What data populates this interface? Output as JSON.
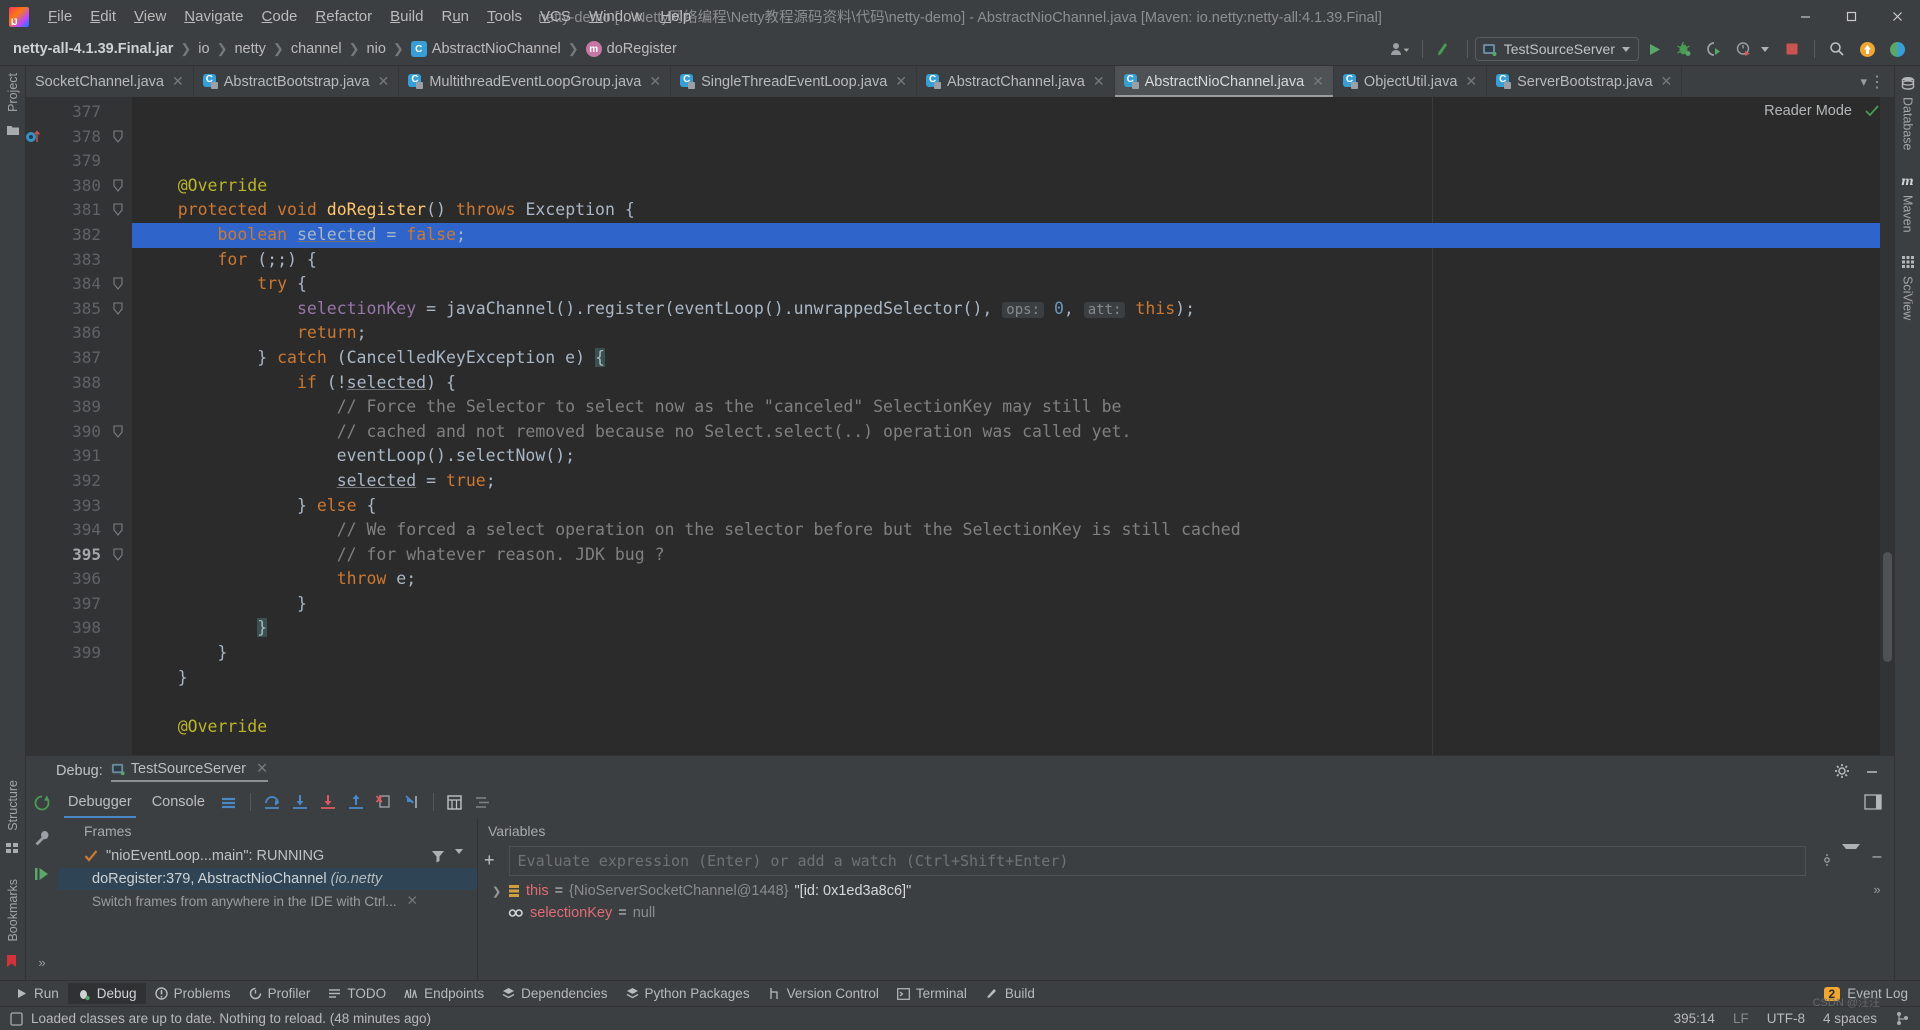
{
  "window": {
    "title": "netty-demo [...\\Netty网络编程\\Netty教程源码资料\\代码\\netty-demo] - AbstractNioChannel.java [Maven: io.netty:netty-all:4.1.39.Final]",
    "minimize_label": "–",
    "maximize_label": "❐",
    "close_label": "✕"
  },
  "menu": {
    "items": [
      {
        "label": "File",
        "accel": "F"
      },
      {
        "label": "Edit",
        "accel": "E"
      },
      {
        "label": "View",
        "accel": "V"
      },
      {
        "label": "Navigate",
        "accel": "N"
      },
      {
        "label": "Code",
        "accel": "C"
      },
      {
        "label": "Refactor",
        "accel": "R"
      },
      {
        "label": "Build",
        "accel": "B"
      },
      {
        "label": "Run",
        "accel": "u"
      },
      {
        "label": "Tools",
        "accel": "T"
      },
      {
        "label": "VCS",
        "accel": "V"
      },
      {
        "label": "Window",
        "accel": "W"
      },
      {
        "label": "Help",
        "accel": "H"
      }
    ]
  },
  "breadcrumb": {
    "items": [
      {
        "label": "netty-all-4.1.39.Final.jar",
        "icon": "",
        "bold": true
      },
      {
        "label": "io",
        "icon": ""
      },
      {
        "label": "netty",
        "icon": ""
      },
      {
        "label": "channel",
        "icon": ""
      },
      {
        "label": "nio",
        "icon": ""
      },
      {
        "label": "AbstractNioChannel",
        "icon": "class-icon"
      },
      {
        "label": "doRegister",
        "icon": "method-icon"
      }
    ],
    "separator": "❯"
  },
  "toolbar": {
    "run_config": "TestSourceServer",
    "icons": [
      {
        "name": "user-accounts-icon"
      },
      {
        "name": "vcs-update-icon"
      },
      {
        "name": "run-icon"
      },
      {
        "name": "debug-icon"
      },
      {
        "name": "run-coverage-icon"
      },
      {
        "name": "profiler-icon"
      },
      {
        "name": "stop-icon"
      },
      {
        "name": "search-everywhere-icon"
      },
      {
        "name": "notifications-icon"
      },
      {
        "name": "ide-feature-icon"
      }
    ]
  },
  "editor_tabs": [
    {
      "label": "SocketChannel.java",
      "active": false,
      "has_icon": false
    },
    {
      "label": "AbstractBootstrap.java",
      "active": false,
      "has_icon": true
    },
    {
      "label": "MultithreadEventLoopGroup.java",
      "active": false,
      "has_icon": true
    },
    {
      "label": "SingleThreadEventLoop.java",
      "active": false,
      "has_icon": true
    },
    {
      "label": "AbstractChannel.java",
      "active": false,
      "has_icon": true
    },
    {
      "label": "AbstractNioChannel.java",
      "active": true,
      "has_icon": true
    },
    {
      "label": "ObjectUtil.java",
      "active": false,
      "has_icon": true
    },
    {
      "label": "ServerBootstrap.java",
      "active": false,
      "has_icon": true
    }
  ],
  "editor": {
    "reader_mode_label": "Reader Mode",
    "first_line": 377,
    "highlight_line": 379,
    "current_line_marker": 395,
    "lines": [
      {
        "no": 377,
        "tokens": [
          {
            "t": "    ",
            "c": "id"
          },
          {
            "t": "@Override",
            "c": "ann"
          }
        ]
      },
      {
        "no": 378,
        "fold": true,
        "bp": true,
        "tokens": [
          {
            "t": "    ",
            "c": "id"
          },
          {
            "t": "protected",
            "c": "kw"
          },
          {
            "t": " ",
            "c": "id"
          },
          {
            "t": "void",
            "c": "kw"
          },
          {
            "t": " ",
            "c": "id"
          },
          {
            "t": "doRegister",
            "c": "mth"
          },
          {
            "t": "() ",
            "c": "id"
          },
          {
            "t": "throws",
            "c": "kw"
          },
          {
            "t": " Exception {",
            "c": "id"
          }
        ]
      },
      {
        "no": 379,
        "hl": true,
        "tokens": [
          {
            "t": "        ",
            "c": "id"
          },
          {
            "t": "boolean",
            "c": "kw"
          },
          {
            "t": " ",
            "c": "id"
          },
          {
            "t": "selected",
            "c": "id und"
          },
          {
            "t": " = ",
            "c": "id"
          },
          {
            "t": "false",
            "c": "kw"
          },
          {
            "t": ";",
            "c": "id"
          }
        ]
      },
      {
        "no": 380,
        "fold": true,
        "tokens": [
          {
            "t": "        ",
            "c": "id"
          },
          {
            "t": "for",
            "c": "kw"
          },
          {
            "t": " (;;) {",
            "c": "id"
          }
        ]
      },
      {
        "no": 381,
        "fold": true,
        "tokens": [
          {
            "t": "            ",
            "c": "id"
          },
          {
            "t": "try",
            "c": "kw"
          },
          {
            "t": " {",
            "c": "id"
          }
        ]
      },
      {
        "no": 382,
        "tokens": [
          {
            "t": "                ",
            "c": "id"
          },
          {
            "t": "selectionKey",
            "c": "fld"
          },
          {
            "t": " = ",
            "c": "id"
          },
          {
            "t": "javaChannel().register(eventLoop().unwrappedSelector(), ",
            "c": "id"
          },
          {
            "t": "ops:",
            "c": "hint"
          },
          {
            "t": " ",
            "c": "id"
          },
          {
            "t": "0",
            "c": "num"
          },
          {
            "t": ", ",
            "c": "id"
          },
          {
            "t": "att:",
            "c": "hint"
          },
          {
            "t": " ",
            "c": "id"
          },
          {
            "t": "this",
            "c": "kw"
          },
          {
            "t": ");",
            "c": "id"
          }
        ]
      },
      {
        "no": 383,
        "tokens": [
          {
            "t": "                ",
            "c": "id"
          },
          {
            "t": "return",
            "c": "kw"
          },
          {
            "t": ";",
            "c": "id"
          }
        ]
      },
      {
        "no": 384,
        "fold": true,
        "tokens": [
          {
            "t": "            } ",
            "c": "id"
          },
          {
            "t": "catch",
            "c": "kw"
          },
          {
            "t": " (CancelledKeyException e) ",
            "c": "id"
          },
          {
            "t": "{",
            "c": "id brace"
          }
        ]
      },
      {
        "no": 385,
        "fold": true,
        "tokens": [
          {
            "t": "                ",
            "c": "id"
          },
          {
            "t": "if",
            "c": "kw"
          },
          {
            "t": " (!",
            "c": "id"
          },
          {
            "t": "selected",
            "c": "id und"
          },
          {
            "t": ") {",
            "c": "id"
          }
        ]
      },
      {
        "no": 386,
        "tokens": [
          {
            "t": "                    ",
            "c": "id"
          },
          {
            "t": "// Force the Selector to select now as the \"canceled\" SelectionKey may still be",
            "c": "cmt"
          }
        ]
      },
      {
        "no": 387,
        "tokens": [
          {
            "t": "                    ",
            "c": "id"
          },
          {
            "t": "// cached and not removed because no Select.select(..) operation was called yet.",
            "c": "cmt"
          }
        ]
      },
      {
        "no": 388,
        "tokens": [
          {
            "t": "                    eventLoop().selectNow();",
            "c": "id"
          }
        ]
      },
      {
        "no": 389,
        "tokens": [
          {
            "t": "                    ",
            "c": "id"
          },
          {
            "t": "selected",
            "c": "id und"
          },
          {
            "t": " = ",
            "c": "id"
          },
          {
            "t": "true",
            "c": "kw"
          },
          {
            "t": ";",
            "c": "id"
          }
        ]
      },
      {
        "no": 390,
        "fold": true,
        "tokens": [
          {
            "t": "                } ",
            "c": "id"
          },
          {
            "t": "else",
            "c": "kw"
          },
          {
            "t": " {",
            "c": "id"
          }
        ]
      },
      {
        "no": 391,
        "tokens": [
          {
            "t": "                    ",
            "c": "id"
          },
          {
            "t": "// We forced a select operation on the selector before but the SelectionKey is still cached",
            "c": "cmt"
          }
        ]
      },
      {
        "no": 392,
        "tokens": [
          {
            "t": "                    ",
            "c": "id"
          },
          {
            "t": "// for whatever reason. JDK bug ?",
            "c": "cmt"
          }
        ]
      },
      {
        "no": 393,
        "tokens": [
          {
            "t": "                    ",
            "c": "id"
          },
          {
            "t": "throw",
            "c": "kw"
          },
          {
            "t": " e;",
            "c": "id"
          }
        ]
      },
      {
        "no": 394,
        "fold": true,
        "tokens": [
          {
            "t": "                }",
            "c": "id"
          }
        ]
      },
      {
        "no": 395,
        "fold": true,
        "current": true,
        "tokens": [
          {
            "t": "            ",
            "c": "id"
          },
          {
            "t": "}",
            "c": "id brace"
          }
        ]
      },
      {
        "no": 396,
        "tokens": [
          {
            "t": "        }",
            "c": "id"
          }
        ]
      },
      {
        "no": 397,
        "tokens": [
          {
            "t": "    }",
            "c": "id"
          }
        ]
      },
      {
        "no": 398,
        "tokens": [
          {
            "t": "",
            "c": "id"
          }
        ]
      },
      {
        "no": 399,
        "tokens": [
          {
            "t": "    ",
            "c": "id"
          },
          {
            "t": "@Override",
            "c": "ann"
          }
        ]
      }
    ]
  },
  "left_stripe": {
    "top": [
      {
        "label": "Project",
        "icon": "project-icon"
      }
    ],
    "bottom": [
      {
        "label": "Structure",
        "icon": "structure-icon"
      },
      {
        "label": "Bookmarks",
        "icon": "bookmarks-icon"
      }
    ]
  },
  "right_stripe": {
    "items": [
      {
        "label": "Database",
        "icon": "database-icon"
      },
      {
        "label": "Maven",
        "icon": "maven-icon"
      },
      {
        "label": "SciView",
        "icon": "sciview-icon"
      }
    ]
  },
  "debug": {
    "header_label": "Debug:",
    "config_name": "TestSourceServer",
    "close_label": "✕",
    "tabs": [
      {
        "label": "Debugger",
        "active": true
      },
      {
        "label": "Console",
        "active": false
      }
    ],
    "frames_title": "Frames",
    "variables_title": "Variables",
    "thread": "\"nioEventLoop...main\": RUNNING",
    "frame": "doRegister:379, AbstractNioChannel",
    "frame_pkg": "(io.netty",
    "frame_hint": "Switch frames from anywhere in the IDE with Ctrl...",
    "eval_placeholder": "Evaluate expression (Enter) or add a watch (Ctrl+Shift+Enter)",
    "variables": [
      {
        "name": "this",
        "value_type": "{NioServerSocketChannel@1448}",
        "value_str": "\"[id: 0x1ed3a8c6]\"",
        "expandable": true,
        "icon": "object-icon"
      },
      {
        "name": "selectionKey",
        "value_type": "null",
        "value_str": "",
        "expandable": false,
        "icon": "field-icon"
      }
    ],
    "var_eq": "=",
    "rail_icons": [
      "rerun-icon",
      "settings-wrench-icon",
      "resume-icon",
      "expand-icon"
    ],
    "toolbar_icons": [
      {
        "name": "rerun-debug-icon"
      },
      {
        "name": "mute-breakpoints-icon"
      },
      {
        "name": "step-over-icon"
      },
      {
        "name": "step-into-icon"
      },
      {
        "name": "force-step-into-icon"
      },
      {
        "name": "step-out-icon"
      },
      {
        "name": "drop-frame-icon"
      },
      {
        "name": "run-to-cursor-icon"
      },
      {
        "name": "evaluate-expression-icon"
      },
      {
        "name": "settings-icon"
      }
    ],
    "settings_icon": "gear-icon",
    "minimize_icon": "minimize-icon",
    "layout_icon": "layout-icon",
    "plus_label": "+",
    "minus_label": "–",
    "chevrons_label": "»"
  },
  "toolwindow_bar": {
    "items": [
      {
        "label": "Run",
        "icon": "run-icon",
        "active": false
      },
      {
        "label": "Debug",
        "icon": "debug-icon",
        "active": true
      },
      {
        "label": "Problems",
        "icon": "problems-icon",
        "active": false
      },
      {
        "label": "Profiler",
        "icon": "profiler-icon",
        "active": false
      },
      {
        "label": "TODO",
        "icon": "todo-icon",
        "active": false
      },
      {
        "label": "Endpoints",
        "icon": "endpoints-icon",
        "active": false
      },
      {
        "label": "Dependencies",
        "icon": "dependencies-icon",
        "active": false
      },
      {
        "label": "Python Packages",
        "icon": "python-packages-icon",
        "active": false
      },
      {
        "label": "Version Control",
        "icon": "version-control-icon",
        "active": false
      },
      {
        "label": "Terminal",
        "icon": "terminal-icon",
        "active": false
      },
      {
        "label": "Build",
        "icon": "build-icon",
        "active": false
      }
    ],
    "event_log": {
      "label": "Event Log",
      "count": "2"
    }
  },
  "status_bar": {
    "message": "Loaded classes are up to date. Nothing to reload. (48 minutes ago)",
    "caret": "395:14",
    "line_sep": "LF",
    "encoding": "UTF-8",
    "indent": "4 spaces",
    "watermark": "CSDN @汪汪"
  },
  "colors": {
    "accent": "#2f65ca",
    "panel": "#3c3f41",
    "editor_bg": "#2b2b2b",
    "gutter": "#313335",
    "keyword": "#cc7832",
    "string": "#6a8759",
    "comment": "#808080",
    "number": "#6897bb",
    "field": "#9876aa",
    "method": "#ffc66d",
    "annotation": "#bbb529",
    "frame_sel": "#2f4556"
  }
}
